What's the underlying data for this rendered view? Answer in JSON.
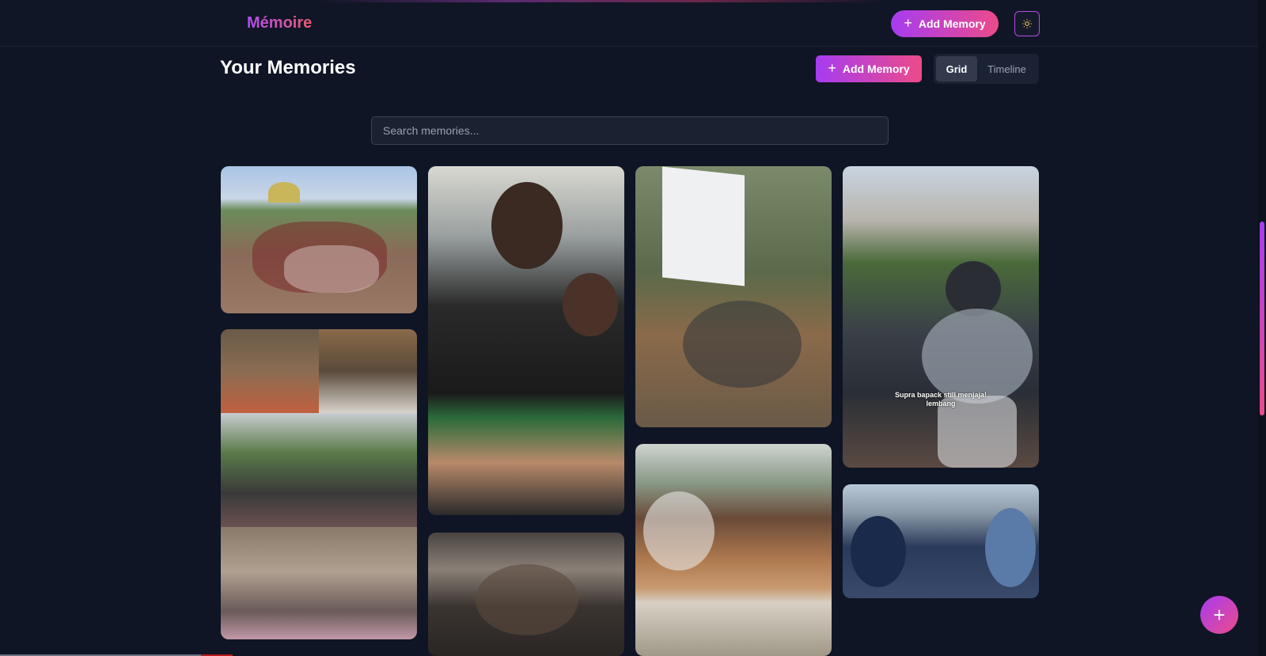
{
  "nav": {
    "logo": "Mémoire",
    "add_memory_label": "Add Memory",
    "theme_icon": "sun-icon"
  },
  "header": {
    "title": "Your Memories",
    "add_memory_label": "Add Memory",
    "views": [
      {
        "label": "Grid",
        "active": true
      },
      {
        "label": "Timeline",
        "active": false
      }
    ]
  },
  "search": {
    "placeholder": "Search memories...",
    "value": ""
  },
  "gallery": {
    "photos": [
      {
        "name": "memory-photo-group-mosque"
      },
      {
        "name": "memory-photo-collage-friends"
      },
      {
        "name": "memory-photo-phone-selfie"
      },
      {
        "name": "memory-photo-group-indoor"
      },
      {
        "name": "memory-photo-forest-screen"
      },
      {
        "name": "memory-photo-cafe-dinner"
      },
      {
        "name": "memory-photo-motorbike-ride",
        "caption_line1": "Supra bapack still menjaja!",
        "caption_line2": "lembang"
      },
      {
        "name": "memory-photo-cafe-selfie"
      }
    ]
  },
  "fab": {
    "icon": "plus-icon"
  },
  "colors": {
    "background": "#0f1524",
    "accent_start": "#a63cf0",
    "accent_end": "#ec4b8a"
  }
}
